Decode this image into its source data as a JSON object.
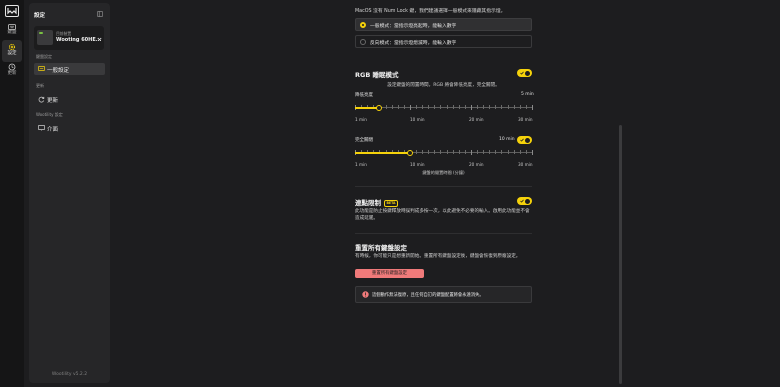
{
  "rail": {
    "items": [
      {
        "label": "鍵盤",
        "icon": "keyboard-icon"
      },
      {
        "label": "設定",
        "icon": "gear-icon"
      },
      {
        "label": "更新",
        "icon": "clock-icon"
      }
    ]
  },
  "sidebar": {
    "title": "設定",
    "device": {
      "current_label": "目前裝置",
      "name": "Wooting 60HE..."
    },
    "sections": [
      {
        "heading": "鍵盤設定",
        "items": [
          "一般設定"
        ]
      },
      {
        "heading": "更新",
        "items": [
          "更新"
        ]
      },
      {
        "heading": "Wootility 設定",
        "items": [
          "介面"
        ]
      }
    ],
    "version": "Wootility v5.2.2"
  },
  "main": {
    "numlock_intro": "MacOS 沒有 Num Lock 鍵，我們建議選擇一般模式來隱藏其指示燈。",
    "numlock_options": [
      {
        "label": "一般模式：當指示燈亮起時，能輸入數字",
        "selected": true
      },
      {
        "label": "反向模式：當指示燈熄滅時，能輸入數字",
        "selected": false
      }
    ],
    "rgb": {
      "title": "RGB 睡眠模式",
      "enabled": true,
      "description": "設定鍵盤的閒置時間，RGB 將會降低亮度，完全關閉。",
      "dim": {
        "label": "降低亮度",
        "value_text": "5 min",
        "value": 5
      },
      "off": {
        "label": "完全關閉",
        "value_text": "10 min",
        "value": 10,
        "enabled": true
      },
      "ticks": [
        "1 min",
        "10 min",
        "20 min",
        "30 min"
      ],
      "axis_caption": "鍵盤的閒置時間 (分鐘)"
    },
    "tachyon": {
      "title": "連點限制",
      "badge": "BETA",
      "enabled": true,
      "description": "此功能是防止按鍵釋放時誤判成多按一次，以此避免不必要的輸入。啟用此功能並不會造成延遲。"
    },
    "reset": {
      "title": "重置所有鍵盤設定",
      "description": "有時候，你可能只是想重新開始。重置所有鍵盤設定後，鍵盤會恢復到原廠設定。",
      "button": "重置所有鍵盤設定",
      "warning": "這個動作無法復原，且任何自訂的鍵盤配置將會永遠消失。"
    }
  },
  "colors": {
    "accent": "#f5d20b",
    "danger": "#f07a7a",
    "background": "#1d1d1f",
    "panel": "#262628"
  }
}
